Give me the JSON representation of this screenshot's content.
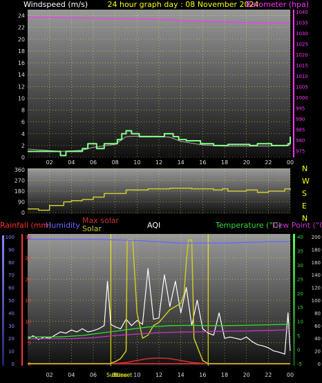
{
  "header": {
    "title": "24 hour graph day : 08 November 2024",
    "left_label": "Windspeed (m/s)",
    "right_label": "Barometer (hpa)"
  },
  "colors": {
    "background": "#000000",
    "title": "#ffff00",
    "wind": "#88ff88",
    "wind_avg": "#aaaaaa",
    "barometer": "#ff33ff",
    "direction": "#cccc33",
    "compass": "#ffff00",
    "rain": "#ff3333",
    "humidity": "#6666ff",
    "max_solar": "#cc3333",
    "solar": "#cccc22",
    "temperature": "#33dd33",
    "dewpoint": "#cc33cc",
    "aqi": "#ffffff",
    "grid": "#ffff66"
  },
  "x_axis": {
    "ticks": [
      "02",
      "04",
      "06",
      "08",
      "10",
      "12",
      "14",
      "16",
      "18",
      "20",
      "22",
      "00"
    ]
  },
  "wind_panel": {
    "left_ticks": [
      "24",
      "22",
      "20",
      "18",
      "16",
      "14",
      "12",
      "10",
      "8",
      "6",
      "4",
      "2",
      "0"
    ],
    "right_ticks": [
      "1040",
      "1035",
      "1030",
      "1025",
      "1020",
      "1015",
      "1010",
      "1005",
      "1000",
      "995",
      "990",
      "985",
      "980",
      "975"
    ]
  },
  "dir_panel": {
    "ticks": [
      "360",
      "270",
      "180",
      "90",
      "0"
    ],
    "compass": [
      "N",
      "W",
      "S",
      "E",
      "N"
    ]
  },
  "bottom_panel": {
    "legend_left": {
      "rainfall": "Rainfall (mm)",
      "humidity": "Humidity",
      "max_solar": "Max solar",
      "solar": "Solar",
      "aqi": "AQI"
    },
    "legend_right": {
      "temperature": "Temperature (°C)",
      "dewpoint": "Dew Point (°C)"
    },
    "rain_ticks": [
      "30",
      "25",
      "20",
      "15",
      "10",
      "5",
      "0"
    ],
    "hum_ticks": [
      "100",
      "90",
      "80",
      "70",
      "60",
      "50",
      "40",
      "30",
      "20",
      "10",
      "0"
    ],
    "temp_ticks": [
      "40",
      "35",
      "30",
      "25",
      "20",
      "15",
      "10",
      "5",
      "0",
      "-5"
    ],
    "solar_ticks": [
      "200",
      "180",
      "160",
      "140",
      "120",
      "100",
      "80",
      "60",
      "40",
      "20",
      "0"
    ],
    "sunrise_label": "Sunrise",
    "sunset_label": "Sunset"
  },
  "chart_data": [
    {
      "type": "line",
      "name": "wind_and_pressure",
      "xlabel": "",
      "xlim": [
        0,
        24
      ],
      "ylabel": "Windspeed (m/s)",
      "ylim": [
        0,
        25
      ],
      "y2label": "Barometer (hpa)",
      "y2lim": [
        972,
        1041
      ],
      "series": [
        {
          "name": "Windspeed (m/s)",
          "axis": "left",
          "style": "step",
          "points": [
            [
              0,
              1
            ],
            [
              2,
              1
            ],
            [
              3,
              0.3
            ],
            [
              3.5,
              1
            ],
            [
              4.5,
              1
            ],
            [
              5,
              1.5
            ],
            [
              5.5,
              2.3
            ],
            [
              6.3,
              1.5
            ],
            [
              7,
              2.3
            ],
            [
              7.8,
              2.3
            ],
            [
              8.2,
              3
            ],
            [
              8.6,
              4
            ],
            [
              9.0,
              4.5
            ],
            [
              9.5,
              4
            ],
            [
              10.2,
              3.5
            ],
            [
              12.5,
              4
            ],
            [
              13.3,
              3.5
            ],
            [
              13.8,
              3
            ],
            [
              14.5,
              2.8
            ],
            [
              15.8,
              2.3
            ],
            [
              17,
              2
            ],
            [
              18.3,
              2.2
            ],
            [
              20.3,
              2
            ],
            [
              21,
              2.3
            ],
            [
              22.3,
              2
            ],
            [
              23.8,
              2.3
            ],
            [
              24,
              3.5
            ]
          ]
        },
        {
          "name": "Average windspeed",
          "axis": "left",
          "style": "line",
          "points": [
            [
              0,
              1.4
            ],
            [
              3,
              1
            ],
            [
              5,
              1.2
            ],
            [
              6,
              1.7
            ],
            [
              8,
              2.2
            ],
            [
              9,
              3.5
            ],
            [
              10,
              3.6
            ],
            [
              12,
              3.6
            ],
            [
              13,
              3.4
            ],
            [
              14,
              2.7
            ],
            [
              16,
              2.1
            ],
            [
              18,
              1.9
            ],
            [
              20,
              1.9
            ],
            [
              22,
              1.9
            ],
            [
              24,
              2.1
            ]
          ]
        },
        {
          "name": "Barometer (hpa)",
          "axis": "right",
          "style": "line",
          "points": [
            [
              0,
              1037.5
            ],
            [
              4,
              1037.2
            ],
            [
              8,
              1036.8
            ],
            [
              12,
              1036.5
            ],
            [
              14,
              1036
            ],
            [
              16,
              1035.5
            ],
            [
              18,
              1035.3
            ],
            [
              20,
              1035
            ],
            [
              22,
              1034.8
            ],
            [
              24,
              1034.7
            ]
          ]
        }
      ]
    },
    {
      "type": "line",
      "name": "wind_direction",
      "xlim": [
        0,
        24
      ],
      "ylim": [
        0,
        360
      ],
      "series": [
        {
          "name": "Wind direction",
          "style": "step",
          "points": [
            [
              0,
              30
            ],
            [
              1,
              20
            ],
            [
              2,
              60
            ],
            [
              3,
              60
            ],
            [
              3.3,
              90
            ],
            [
              4,
              100
            ],
            [
              5,
              110
            ],
            [
              6,
              130
            ],
            [
              7,
              160
            ],
            [
              9,
              190
            ],
            [
              11,
              200
            ],
            [
              13,
              205
            ],
            [
              15,
              200
            ],
            [
              17,
              190
            ],
            [
              17.8,
              200
            ],
            [
              18.3,
              180
            ],
            [
              20,
              190
            ],
            [
              21,
              170
            ],
            [
              22,
              180
            ],
            [
              23.5,
              200
            ],
            [
              24,
              190
            ]
          ]
        }
      ]
    },
    {
      "type": "line",
      "name": "rain_humidity_solar_temperature",
      "xlim": [
        0,
        24
      ],
      "y_axes": {
        "rainfall_mm": [
          0,
          30
        ],
        "humidity_pct": [
          0,
          100
        ],
        "temperature_c": [
          -5,
          40
        ],
        "solar": [
          0,
          200
        ]
      },
      "series": [
        {
          "name": "Rainfall (mm)",
          "axis": "rainfall_mm",
          "points": [
            [
              0,
              0
            ],
            [
              24,
              0
            ]
          ]
        },
        {
          "name": "Humidity",
          "axis": "humidity_pct",
          "points": [
            [
              0,
              98
            ],
            [
              6,
              98
            ],
            [
              10,
              97
            ],
            [
              12,
              96
            ],
            [
              14,
              95
            ],
            [
              16,
              95
            ],
            [
              18,
              95
            ],
            [
              20,
              95.5
            ],
            [
              22,
              96
            ],
            [
              24,
              96
            ]
          ]
        },
        {
          "name": "Temperature (°C)",
          "axis": "temperature_c",
          "points": [
            [
              0,
              4.5
            ],
            [
              3,
              4.5
            ],
            [
              5,
              5
            ],
            [
              7,
              6
            ],
            [
              8,
              6.5
            ],
            [
              9,
              7
            ],
            [
              10,
              7.5
            ],
            [
              11,
              8
            ],
            [
              12,
              8.2
            ],
            [
              13,
              8.5
            ],
            [
              15,
              8.6
            ],
            [
              16,
              8.5
            ],
            [
              18,
              8.5
            ],
            [
              20,
              8.6
            ],
            [
              22,
              8.8
            ],
            [
              24,
              9
            ]
          ]
        },
        {
          "name": "Dew Point (°C)",
          "axis": "temperature_c",
          "points": [
            [
              0,
              3.8
            ],
            [
              4,
              3.9
            ],
            [
              6,
              4.2
            ],
            [
              8,
              5
            ],
            [
              10,
              5.5
            ],
            [
              12,
              6
            ],
            [
              14,
              6.2
            ],
            [
              16,
              6.3
            ],
            [
              18,
              6.5
            ],
            [
              20,
              6.6
            ],
            [
              22,
              6.8
            ],
            [
              24,
              7
            ]
          ]
        },
        {
          "name": "Max solar",
          "axis": "solar",
          "points": [
            [
              7.7,
              0
            ],
            [
              9,
              2
            ],
            [
              10,
              5
            ],
            [
              11,
              8
            ],
            [
              12,
              9
            ],
            [
              13,
              8
            ],
            [
              14,
              5
            ],
            [
              15,
              2
            ],
            [
              16.4,
              0
            ]
          ]
        },
        {
          "name": "Solar",
          "axis": "solar",
          "points": [
            [
              0,
              0
            ],
            [
              7.5,
              0
            ],
            [
              8,
              3
            ],
            [
              8.5,
              8
            ],
            [
              9,
              20
            ],
            [
              9.1,
              195
            ],
            [
              9.6,
              195
            ],
            [
              10,
              80
            ],
            [
              10.5,
              40
            ],
            [
              11,
              45
            ],
            [
              11.5,
              60
            ],
            [
              12,
              65
            ],
            [
              12.5,
              75
            ],
            [
              13,
              85
            ],
            [
              13.5,
              90
            ],
            [
              14,
              95
            ],
            [
              14.3,
              110
            ],
            [
              14.5,
              160
            ],
            [
              14.7,
              195
            ],
            [
              15,
              195
            ],
            [
              15.2,
              40
            ],
            [
              16,
              5
            ],
            [
              16.5,
              0
            ],
            [
              24,
              0
            ]
          ]
        },
        {
          "name": "AQI",
          "axis": "solar",
          "points": [
            [
              0,
              39
            ],
            [
              0.5,
              44
            ],
            [
              1,
              38
            ],
            [
              1.5,
              42
            ],
            [
              2,
              40
            ],
            [
              2.5,
              45
            ],
            [
              3,
              50
            ],
            [
              3.5,
              48
            ],
            [
              4,
              53
            ],
            [
              4.5,
              50
            ],
            [
              5,
              55
            ],
            [
              5.5,
              50
            ],
            [
              6,
              52
            ],
            [
              6.5,
              55
            ],
            [
              7,
              60
            ],
            [
              7.3,
              130
            ],
            [
              7.6,
              62
            ],
            [
              8,
              58
            ],
            [
              8.5,
              55
            ],
            [
              9,
              70
            ],
            [
              9.5,
              60
            ],
            [
              10,
              68
            ],
            [
              10.5,
              62
            ],
            [
              11,
              150
            ],
            [
              11.5,
              70
            ],
            [
              12,
              72
            ],
            [
              12.5,
              140
            ],
            [
              13,
              90
            ],
            [
              13.5,
              130
            ],
            [
              14,
              80
            ],
            [
              14.5,
              120
            ],
            [
              15,
              60
            ],
            [
              15.5,
              100
            ],
            [
              16,
              55
            ],
            [
              16.5,
              48
            ],
            [
              17,
              45
            ],
            [
              17.5,
              80
            ],
            [
              18,
              40
            ],
            [
              18.5,
              42
            ],
            [
              19,
              40
            ],
            [
              19.5,
              38
            ],
            [
              20,
              42
            ],
            [
              20.5,
              35
            ],
            [
              21,
              30
            ],
            [
              21.5,
              28
            ],
            [
              22,
              25
            ],
            [
              22.5,
              20
            ],
            [
              23,
              18
            ],
            [
              23.5,
              15
            ],
            [
              23.8,
              80
            ],
            [
              24,
              20
            ]
          ]
        }
      ]
    }
  ]
}
